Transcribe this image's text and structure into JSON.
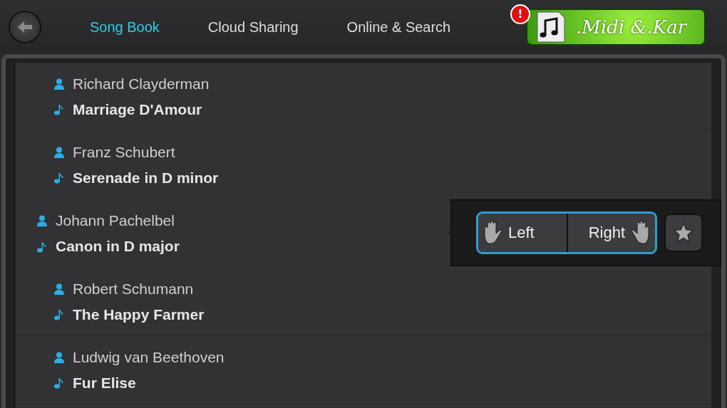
{
  "tabs": [
    {
      "label": "Song Book",
      "selected": true
    },
    {
      "label": "Cloud Sharing",
      "selected": false
    },
    {
      "label": "Online & Search",
      "selected": false
    }
  ],
  "logo": {
    "text": ".Midi &.Kar",
    "badge": "!"
  },
  "songs": [
    {
      "artist": "Richard Clayderman",
      "title": "Marriage D'Amour",
      "expanded": false
    },
    {
      "artist": "Franz Schubert",
      "title": "Serenade in D minor",
      "expanded": false
    },
    {
      "artist": "Johann Pachelbel",
      "title": "Canon in D major",
      "expanded": true
    },
    {
      "artist": "Robert Schumann",
      "title": "The Happy Farmer",
      "expanded": false
    },
    {
      "artist": "Ludwig van Beethoven",
      "title": "Fur Elise",
      "expanded": false
    }
  ],
  "actions": {
    "left": "Left",
    "right": "Right"
  }
}
